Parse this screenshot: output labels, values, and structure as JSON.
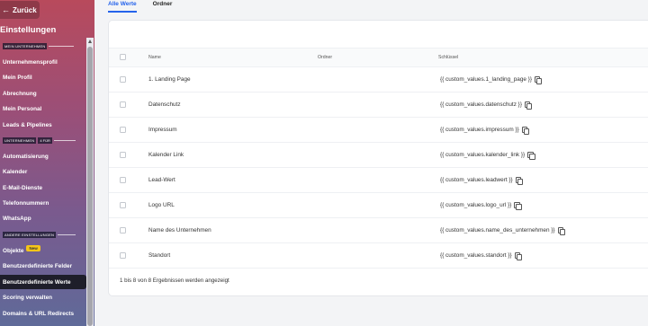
{
  "sidebar": {
    "back_label": "Zurück",
    "title": "Einstellungen",
    "sections": [
      {
        "label": "MEIN UNTERNEHMEN",
        "tag": ""
      },
      {
        "label": "UNTERNEHMEN",
        "tag": "4 FÜR"
      },
      {
        "label": "ANDERE EINSTELLUNGEN",
        "tag": ""
      }
    ],
    "items": [
      {
        "label": "Unternehmensprofil"
      },
      {
        "label": "Mein Profil"
      },
      {
        "label": "Abrechnung"
      },
      {
        "label": "Mein Personal"
      },
      {
        "label": "Leads & Pipelines"
      },
      {
        "label": "Automatisierung"
      },
      {
        "label": "Kalender"
      },
      {
        "label": "E-Mail-Dienste"
      },
      {
        "label": "Telefonnummern"
      },
      {
        "label": "WhatsApp"
      },
      {
        "label": "Objekte",
        "badge": "New"
      },
      {
        "label": "Benutzerdefinierte Felder"
      },
      {
        "label": "Benutzerdefinierte Werte",
        "active": true
      },
      {
        "label": "Scoring verwalten"
      },
      {
        "label": "Domains & URL Redirects"
      }
    ]
  },
  "tabs": [
    {
      "label": "Alle Werte",
      "active": true
    },
    {
      "label": "Ordner",
      "active": false
    }
  ],
  "table": {
    "columns": [
      "Name",
      "Ordner",
      "Schlüssel"
    ],
    "rows": [
      {
        "name": "1. Landing Page",
        "folder": "",
        "key": "{{ custom_values.1_landing_page }}"
      },
      {
        "name": "Datenschutz",
        "folder": "",
        "key": "{{ custom_values.datenschutz }}"
      },
      {
        "name": "Impressum",
        "folder": "",
        "key": "{{ custom_values.impressum }}"
      },
      {
        "name": "Kalender Link",
        "folder": "",
        "key": "{{ custom_values.kalender_link }}"
      },
      {
        "name": "Lead-Wert",
        "folder": "",
        "key": "{{ custom_values.leadwert }}"
      },
      {
        "name": "Logo URL",
        "folder": "",
        "key": "{{ custom_values.logo_url }}"
      },
      {
        "name": "Name des Unternehmen",
        "folder": "",
        "key": "{{ custom_values.name_des_unternehmen }}"
      },
      {
        "name": "Standort",
        "folder": "",
        "key": "{{ custom_values.standort }}"
      }
    ],
    "footer": "1 bis 8 von 8 Ergebnissen werden angezeigt"
  },
  "icons": {
    "back": "arrow-left-icon",
    "copy": "copy-icon",
    "scroll_up": "chevron-up-icon"
  },
  "colors": {
    "accent": "#2563eb",
    "badge_new": "#f5c518",
    "active_item": "#1e1e2a"
  }
}
